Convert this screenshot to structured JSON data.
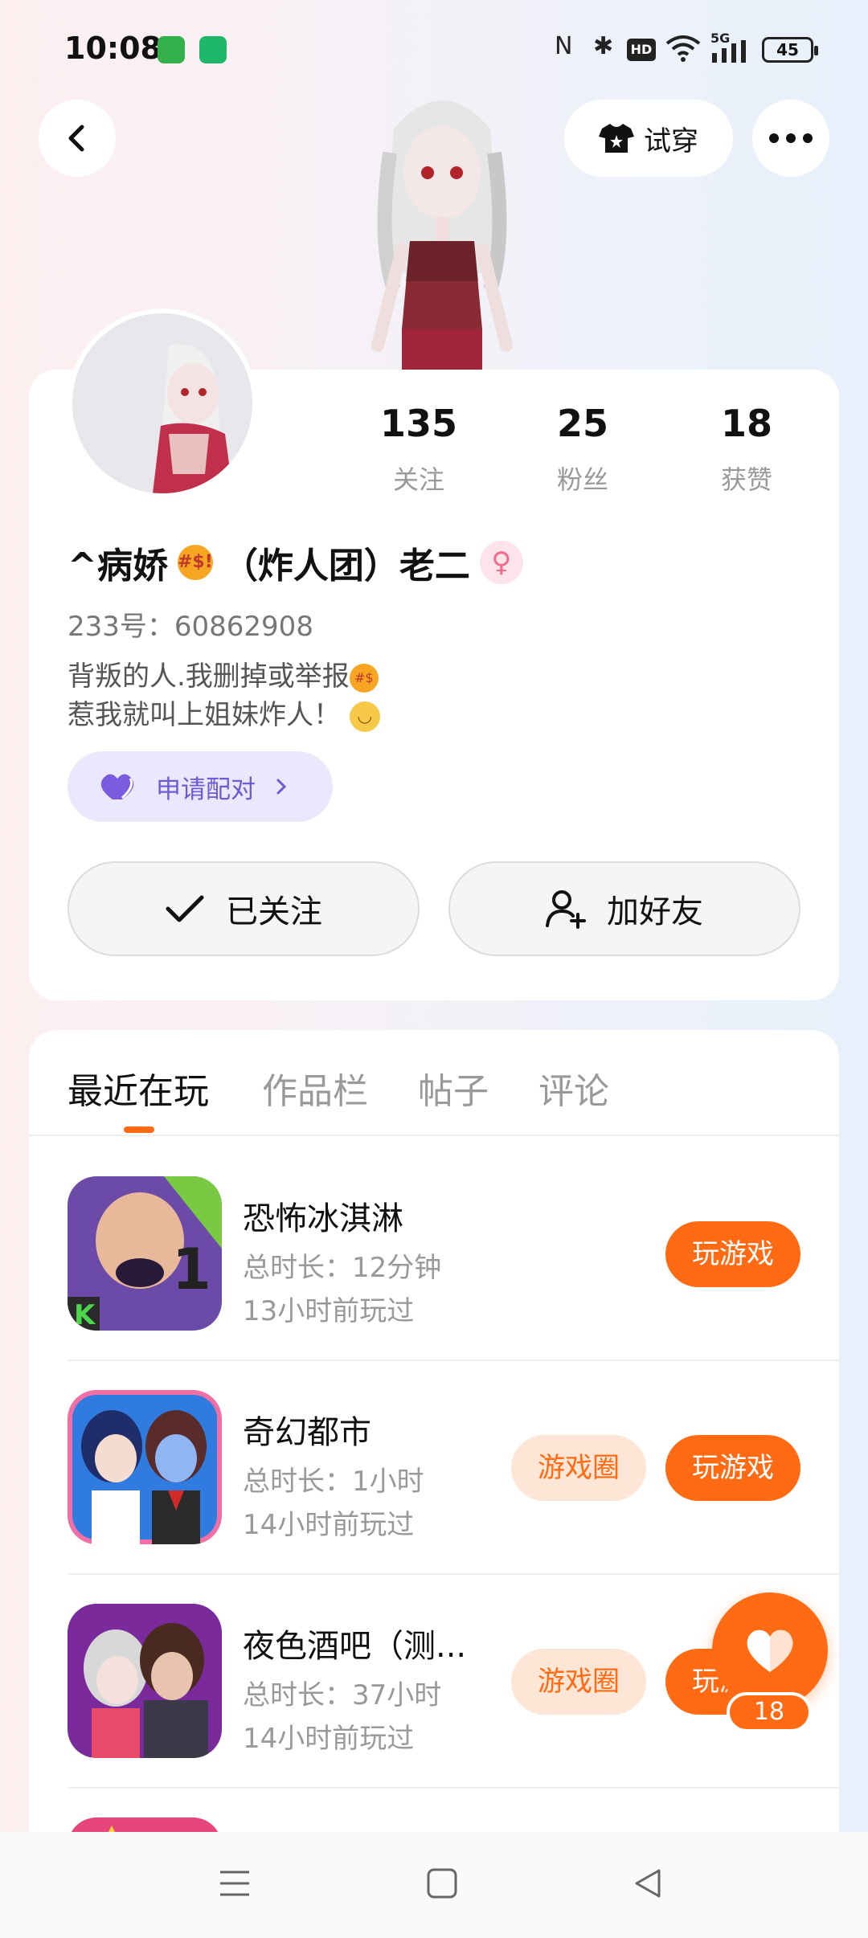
{
  "status_bar": {
    "time": "10:08",
    "battery": "45",
    "signal": "5G",
    "icons": [
      "nfc-icon",
      "bluetooth-icon",
      "hd-icon",
      "wifi-icon",
      "signal-icon",
      "battery-icon"
    ]
  },
  "header": {
    "try_on_label": "试穿"
  },
  "profile": {
    "stats": [
      {
        "value": "135",
        "label": "关注"
      },
      {
        "value": "25",
        "label": "粉丝"
      },
      {
        "value": "18",
        "label": "获赞"
      }
    ],
    "name_prefix": "^病娇",
    "name_suffix": "（炸人团）老二",
    "id_line": "233号：60862908",
    "bio_line1": "背叛的人.我删掉或举报",
    "bio_line2": "惹我就叫上姐妹炸人！",
    "pair_label": "申请配对",
    "followed_label": "已关注",
    "add_friend_label": "加好友"
  },
  "tabs": [
    {
      "label": "最近在玩",
      "active": true
    },
    {
      "label": "作品栏",
      "active": false
    },
    {
      "label": "帖子",
      "active": false
    },
    {
      "label": "评论",
      "active": false
    }
  ],
  "games": [
    {
      "title": "恐怖冰淇淋",
      "duration": "总时长：12分钟",
      "last_played": "13小时前玩过",
      "has_circle": false,
      "play_label": "玩游戏",
      "circle_label": ""
    },
    {
      "title": "奇幻都市",
      "duration": "总时长：1小时",
      "last_played": "14小时前玩过",
      "has_circle": true,
      "play_label": "玩游戏",
      "circle_label": "游戏圈"
    },
    {
      "title": "夜色酒吧（测...",
      "duration": "总时长：37小时",
      "last_played": "14小时前玩过",
      "has_circle": true,
      "play_label": "玩游戏",
      "circle_label": "游戏圈"
    }
  ],
  "floating_like": {
    "count": "18"
  },
  "colors": {
    "accent": "#ff6a13",
    "pair_bg": "#ebe8fd",
    "pair_text": "#6b5bd6"
  }
}
